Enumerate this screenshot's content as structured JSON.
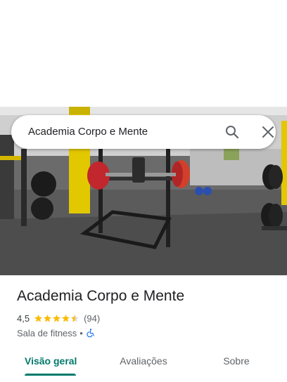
{
  "search": {
    "query": "Academia Corpo e Mente",
    "search_icon": "search-icon",
    "close_icon": "close-icon"
  },
  "photo": {
    "subject": "gym-interior-photo"
  },
  "place": {
    "title": "Academia Corpo e Mente",
    "rating": "4,5",
    "stars_filled": 4.5,
    "stars_total": 5,
    "review_count": "(94)",
    "category": "Sala de fitness",
    "separator": "•",
    "accessibility_icon": "wheelchair-icon"
  },
  "tabs": [
    {
      "label": "Visão geral",
      "active": true
    },
    {
      "label": "Avaliações",
      "active": false
    },
    {
      "label": "Sobre",
      "active": false
    }
  ],
  "colors": {
    "accent": "#00796b",
    "star": "#fbbc04",
    "accessibility": "#1a73e8"
  }
}
